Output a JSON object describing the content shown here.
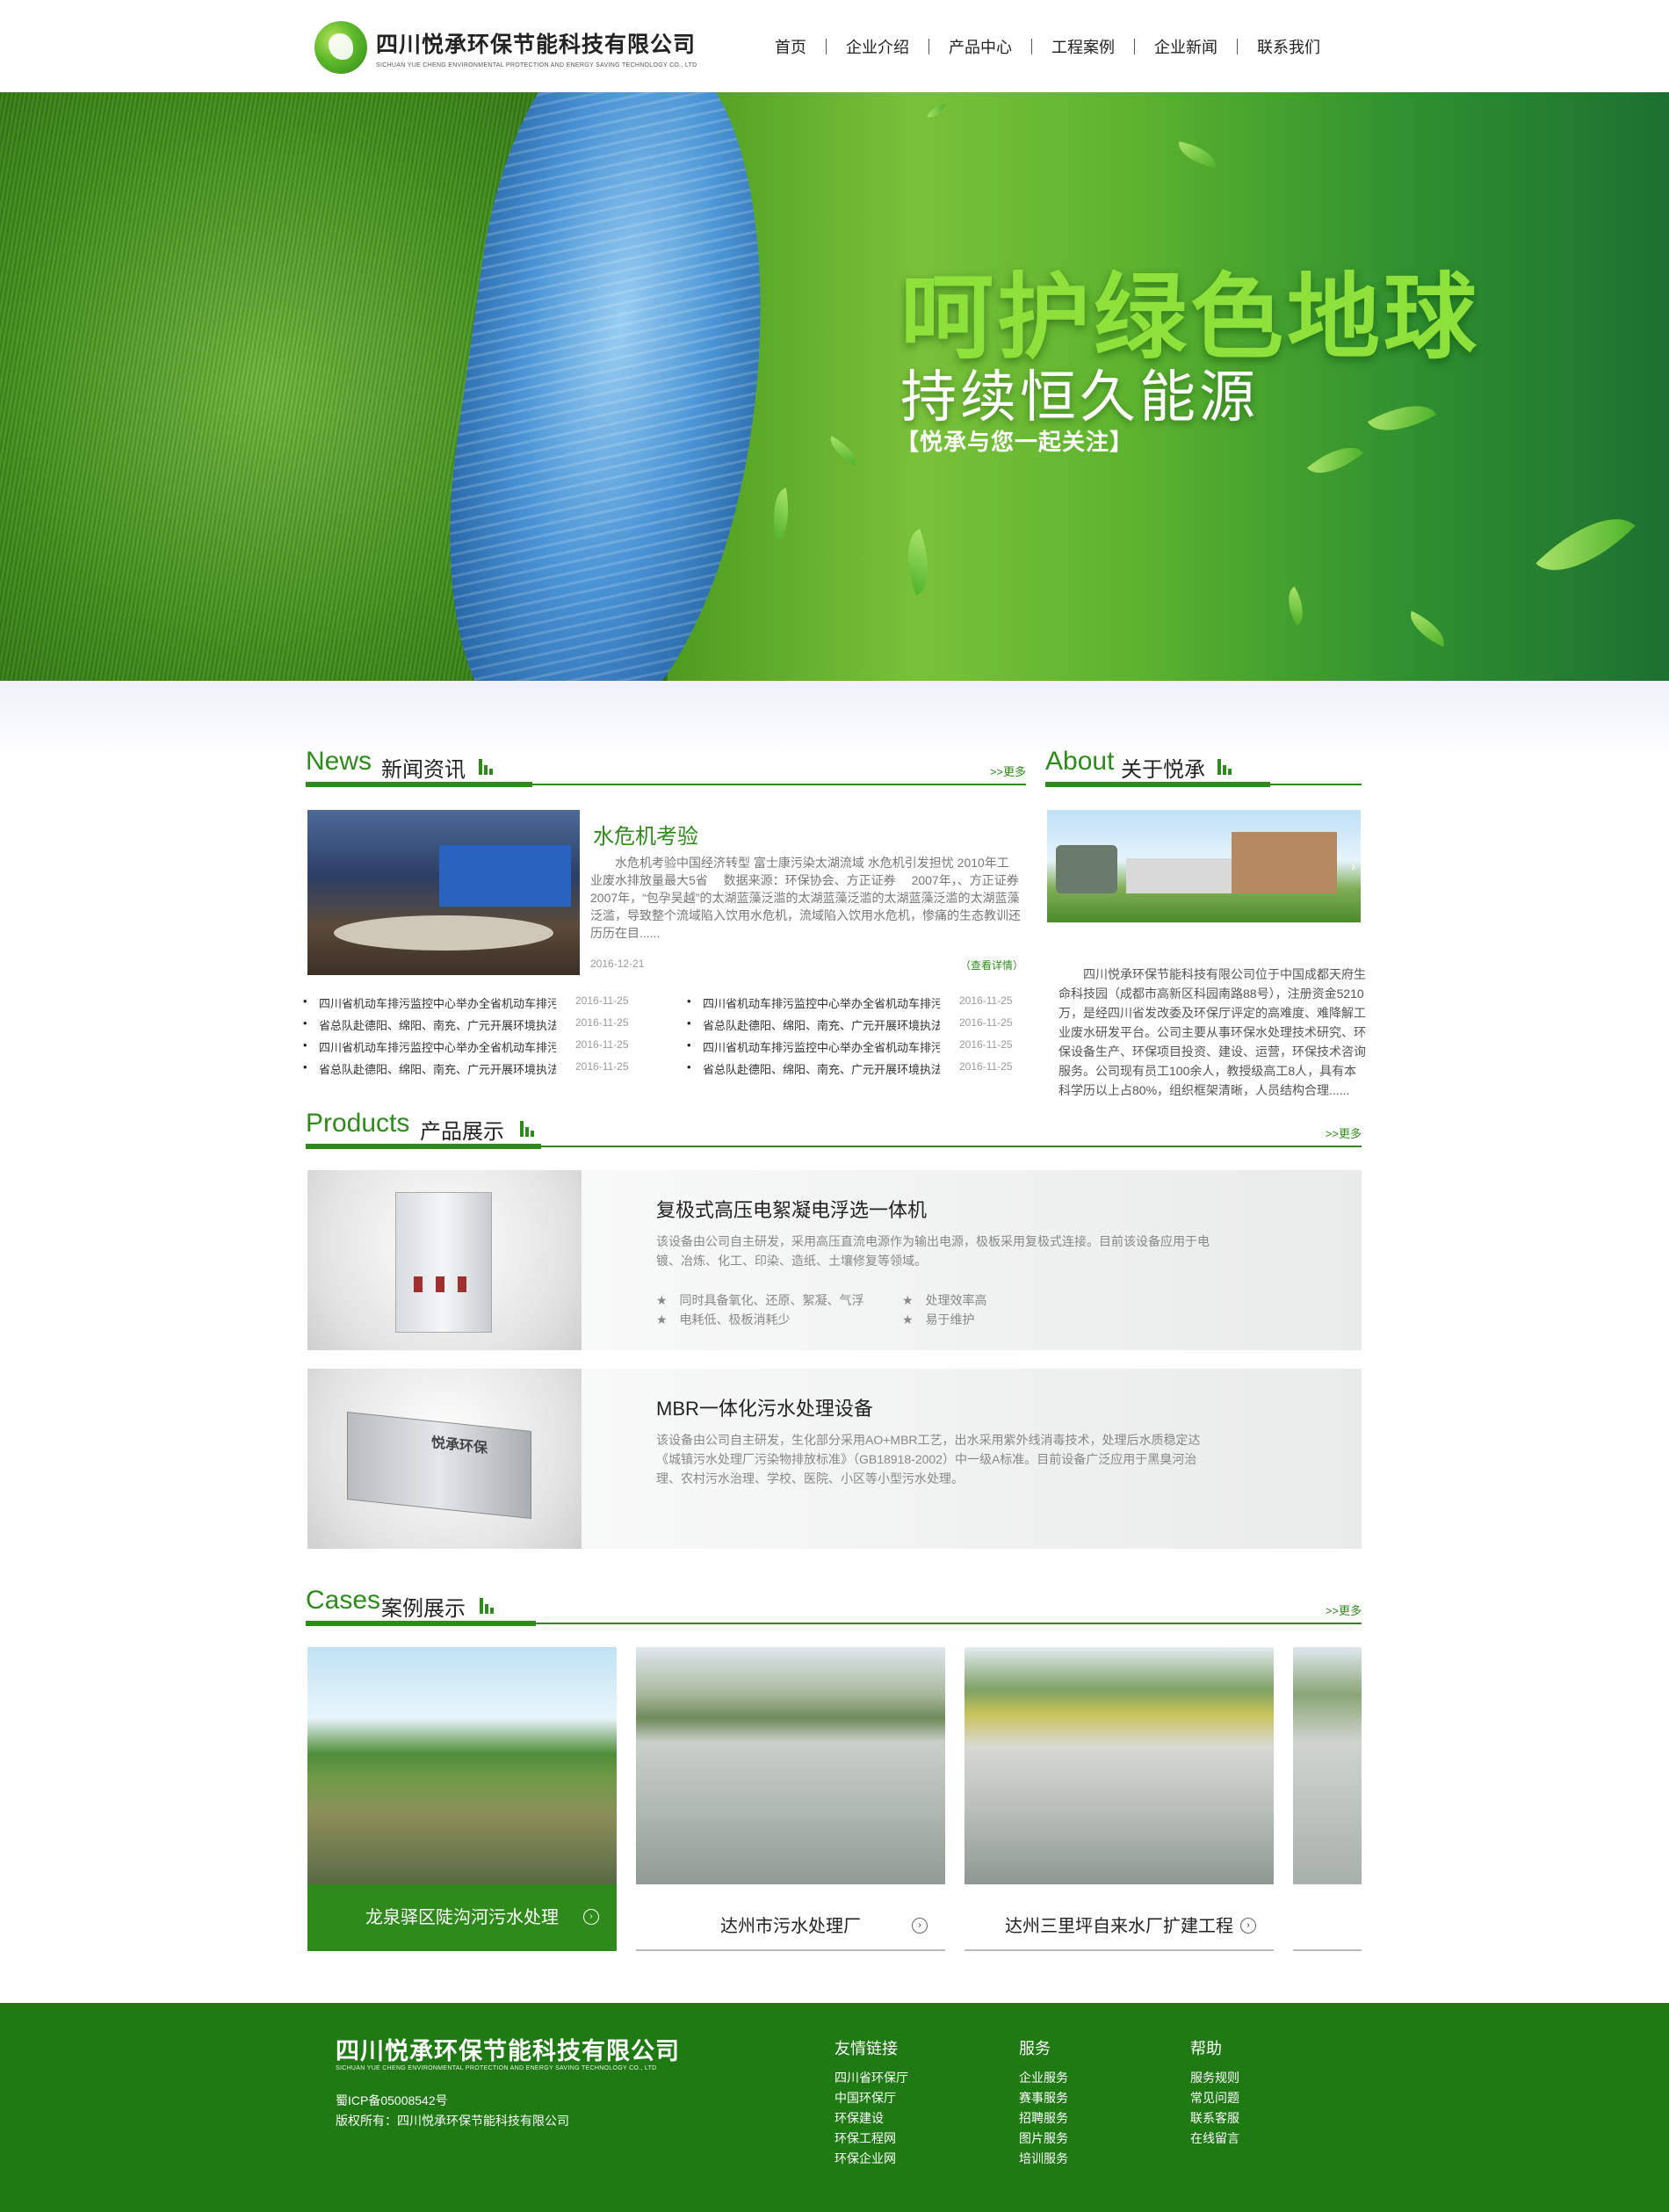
{
  "header": {
    "logo_cn": "四川悦承环保节能科技有限公司",
    "logo_en": "SICHUAN YUE CHENG ENVIRONMENTAL PROTECTION AND ENERGY SAVING TECHNOLOGY CO., LTD",
    "nav": [
      "首页",
      "企业介绍",
      "产品中心",
      "工程案例",
      "企业新闻",
      "联系我们"
    ]
  },
  "banner": {
    "title": "呵护绿色地球",
    "subtitle": "持续恒久能源",
    "tagline": "【悦承与您一起关注】"
  },
  "news": {
    "en": "News",
    "cn": "新闻资讯",
    "more": ">>更多",
    "featured": {
      "title": "水危机考验",
      "body": "水危机考验中国经济转型 富士康污染太湖流域 水危机引发担忧 2010年工业废水排放量最大5省　 数据来源：环保协会、方正证券　 2007年，、方正证券 2007年，“包孕吴越”的太湖蓝藻泛滥的太湖蓝藻泛滥的太湖蓝藻泛滥的太湖蓝藻泛滥，导致整个流域陷入饮用水危机，流域陷入饮用水危机，惨痛的生态教训还历历在目......",
      "date": "2016-12-21",
      "detail": "（查看详情）"
    },
    "list_left": [
      {
        "title": "四川省机动车排污监控中心举办全省机动车排污监控",
        "date": "2016-11-25"
      },
      {
        "title": "省总队赴德阳、绵阳、南充、广元开展环境执法检查",
        "date": "2016-11-25"
      },
      {
        "title": "四川省机动车排污监控中心举办全省机动车排污监控",
        "date": "2016-11-25"
      },
      {
        "title": "省总队赴德阳、绵阳、南充、广元开展环境执法检查",
        "date": "2016-11-25"
      }
    ],
    "list_right": [
      {
        "title": "四川省机动车排污监控中心举办全省机动车排污监控",
        "date": "2016-11-25"
      },
      {
        "title": "省总队赴德阳、绵阳、南充、广元开展环境执法检查",
        "date": "2016-11-25"
      },
      {
        "title": "四川省机动车排污监控中心举办全省机动车排污监控",
        "date": "2016-11-25"
      },
      {
        "title": "省总队赴德阳、绵阳、南充、广元开展环境执法检查",
        "date": "2016-11-25"
      }
    ]
  },
  "about": {
    "en": "About",
    "cn": "关于悦承",
    "text": "四川悦承环保节能科技有限公司位于中国成都天府生命科技园（成都市高新区科园南路88号），注册资金5210万，是经四川省发改委及环保厅评定的高难度、难降解工业废水研发平台。公司主要从事环保水处理技术研究、环保设备生产、环保项目投资、建设、运营，环保技术咨询服务。公司现有员工100余人，教授级高工8人，具有本科学历以上占80%，组织框架清晰，人员结构合理......"
  },
  "products": {
    "en": "Products",
    "cn": "产品展示",
    "more": ">>更多",
    "items": [
      {
        "name": "复极式高压电絮凝电浮选一体机",
        "desc": "该设备由公司自主研发，采用高压直流电源作为输出电源，极板采用复极式连接。目前该设备应用于电镀、冶炼、化工、印染、造纸、土壤修复等领域。",
        "features": [
          "★　同时具备氧化、还原、絮凝、气浮",
          "★　处理效率高",
          "★　电耗低、极板消耗少",
          "★　易于维护"
        ]
      },
      {
        "name": "MBR一体化污水处理设备",
        "desc": "该设备由公司自主研发，生化部分采用AO+MBR工艺，出水采用紫外线消毒技术，处理后水质稳定达《城镇污水处理厂污染物排放标准》（GB18918-2002）中一级A标准。目前设备广泛应用于黑臭河治理、农村污水治理、学校、医院、小区等小型污水处理。",
        "machine_label": "悦承环保"
      }
    ]
  },
  "cases": {
    "en": "Cases",
    "cn": "案例展示",
    "more": ">>更多",
    "items": [
      {
        "title": "龙泉驿区陡沟河污水处理"
      },
      {
        "title": "达州市污水处理厂"
      },
      {
        "title": "达州三里坪自来水厂扩建工程"
      }
    ]
  },
  "footer": {
    "logo_cn": "四川悦承环保节能科技有限公司",
    "logo_en": "SICHUAN YUE CHENG ENVIRONMENTAL PROTECTION AND ENERGY SAVING TECHNOLOGY CO., LTD",
    "icp": "蜀ICP备05008542号",
    "copyright": "版权所有：四川悦承环保节能科技有限公司",
    "columns": [
      {
        "title": "友情链接",
        "links": [
          "四川省环保厅",
          "中国环保厅",
          "环保建设",
          "环保工程网",
          "环保企业网"
        ]
      },
      {
        "title": "服务",
        "links": [
          "企业服务",
          "赛事服务",
          "招聘服务",
          "图片服务",
          "培训服务"
        ]
      },
      {
        "title": "帮助",
        "links": [
          "服务规则",
          "常见问题",
          "联系客服",
          "在线留言"
        ]
      }
    ]
  },
  "colors": {
    "brand_green": "#2e8b1b",
    "footer_green": "#1f7a14",
    "banner_title": "#8ee03a"
  }
}
